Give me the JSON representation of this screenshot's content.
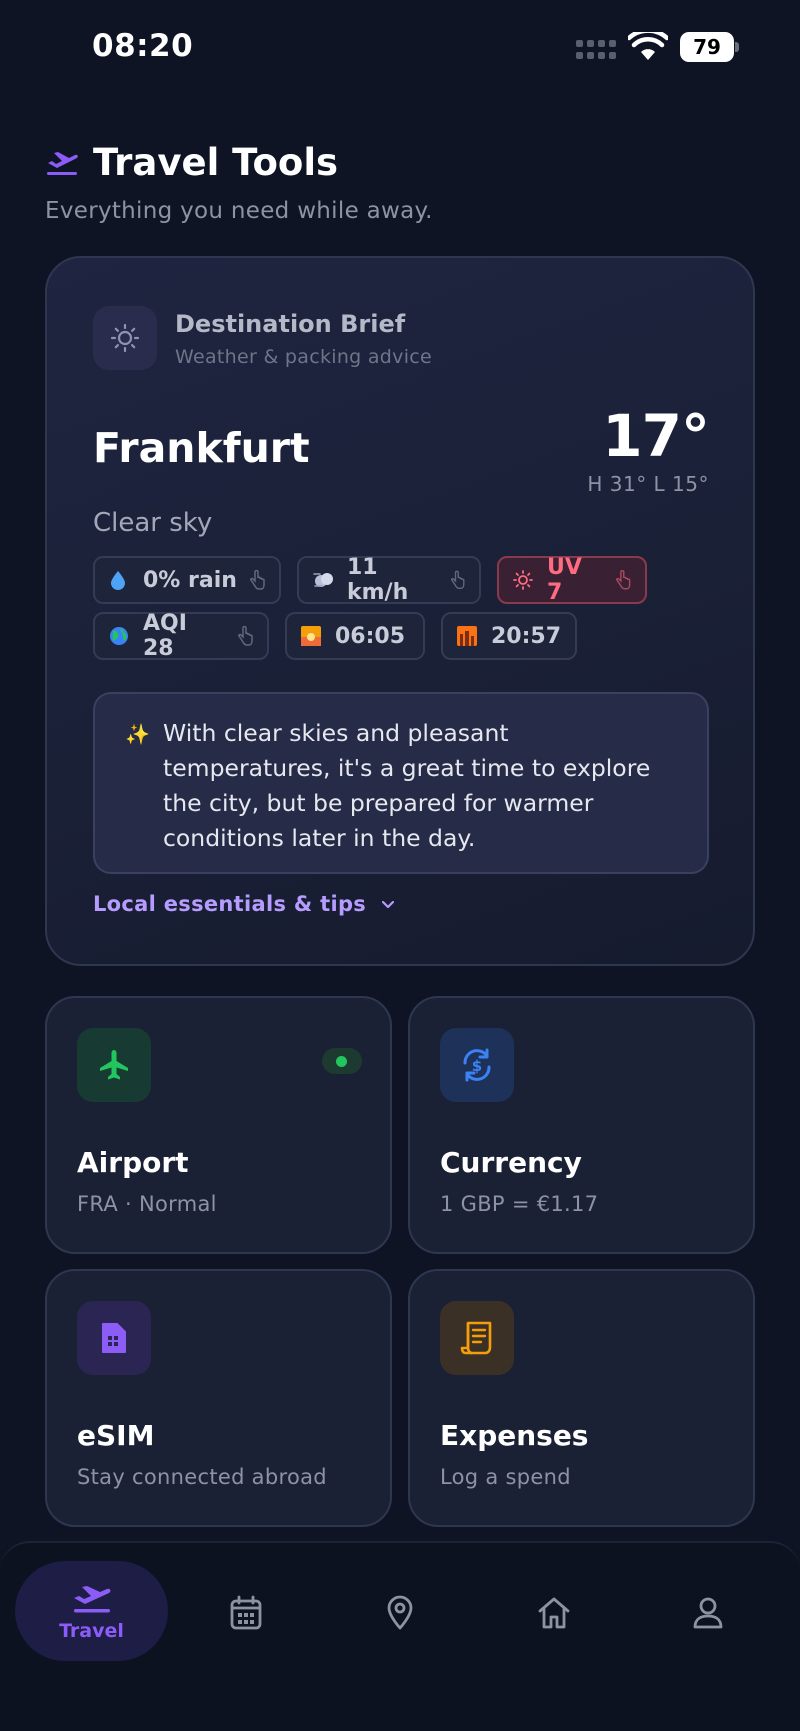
{
  "status_bar": {
    "time": "08:20",
    "battery": "79"
  },
  "header": {
    "title": "Travel Tools",
    "subtitle": "Everything you need while away."
  },
  "destination_brief": {
    "label": "Destination Brief",
    "sublabel": "Weather & packing advice",
    "city": "Frankfurt",
    "temperature": "17°",
    "high_low": "H 31°  L 15°",
    "condition": "Clear sky",
    "chips": [
      {
        "icon": "droplet-icon",
        "text": "0% rain"
      },
      {
        "icon": "wind-icon",
        "text": "11 km/h"
      },
      {
        "icon": "sun-icon",
        "text": "UV 7"
      },
      {
        "icon": "globe-icon",
        "text": "AQI 28"
      },
      {
        "icon": "sunrise-icon",
        "text": "06:05"
      },
      {
        "icon": "sunset-icon",
        "text": "20:57"
      }
    ],
    "tip": "With clear skies and pleasant temperatures, it's a great time to explore the city, but be prepared for warmer conditions later in the day.",
    "essentials_link": "Local essentials & tips"
  },
  "tools": [
    {
      "title": "Airport",
      "subtitle": "FRA · Normal",
      "icon": "plane-icon",
      "accent": "#22c55e"
    },
    {
      "title": "Currency",
      "subtitle": "1 GBP = €1.17",
      "icon": "currency-exchange-icon",
      "accent": "#3b82f6"
    },
    {
      "title": "eSIM",
      "subtitle": "Stay connected abroad",
      "icon": "sim-card-icon",
      "accent": "#8b5cf6"
    },
    {
      "title": "Expenses",
      "subtitle": "Log a spend",
      "icon": "receipt-icon",
      "accent": "#f59e0b"
    }
  ],
  "bottom_nav": {
    "active_label": "Travel",
    "items": [
      "travel-icon",
      "calendar-icon",
      "map-pin-icon",
      "home-icon",
      "profile-icon"
    ]
  },
  "colors": {
    "background": "#0f1424",
    "accent": "#8b5cf6",
    "uv_warning": "#ff6b80"
  }
}
